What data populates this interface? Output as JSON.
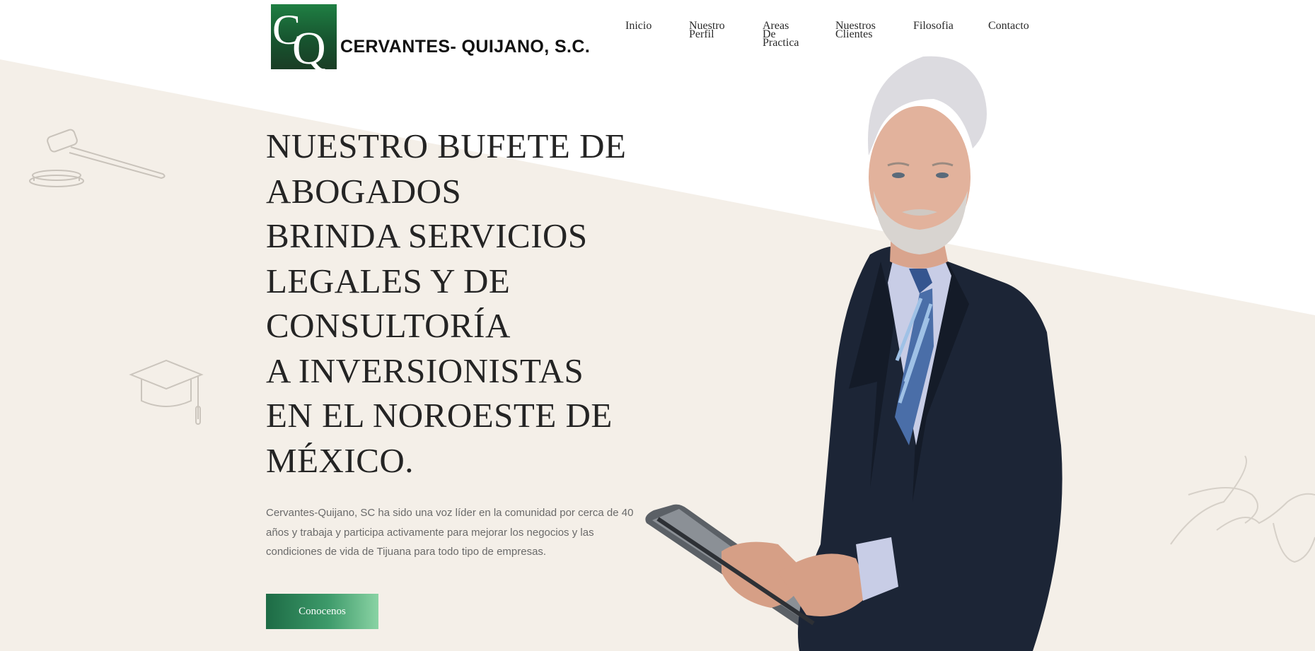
{
  "brand": {
    "logo_letters": "CQ",
    "name": "CERVANTES- QUIJANO, S.C.",
    "logo_colors": [
      "#1f7f43",
      "#1a3d25"
    ]
  },
  "nav": {
    "items": [
      {
        "label": "Inicio"
      },
      {
        "label": "Nuestro Perfil",
        "lines": [
          "Nuestro",
          "Perfil"
        ]
      },
      {
        "label": "Areas De Practica",
        "lines": [
          "Areas",
          "De",
          "Practica"
        ]
      },
      {
        "label": "Nuestros Clientes",
        "lines": [
          "Nuestros",
          "Clientes"
        ]
      },
      {
        "label": "Filosofia"
      },
      {
        "label": "Contacto"
      }
    ]
  },
  "hero": {
    "title_lines": [
      "NUESTRO BUFETE DE",
      "ABOGADOS",
      "BRINDA SERVICIOS",
      "LEGALES Y DE",
      "CONSULTORÍA",
      "A INVERSIONISTAS",
      "EN EL NOROESTE DE",
      "MÉXICO."
    ],
    "description": "Cervantes-Quijano, SC ha sido una voz líder en la comunidad por cerca de 40 años y trabaja y participa activamente para mejorar los negocios y las condiciones de vida de Tijuana para todo tipo de empresas.",
    "cta_label": "Conocenos"
  },
  "colors": {
    "background_wedge": "#f4efe8",
    "accent_green": "#1d6b45",
    "accent_green_light": "#8ad3a4",
    "suit_navy": "#1c2536"
  },
  "decorations": [
    "gavel-icon",
    "graduation-cap-icon",
    "signature-icon"
  ]
}
